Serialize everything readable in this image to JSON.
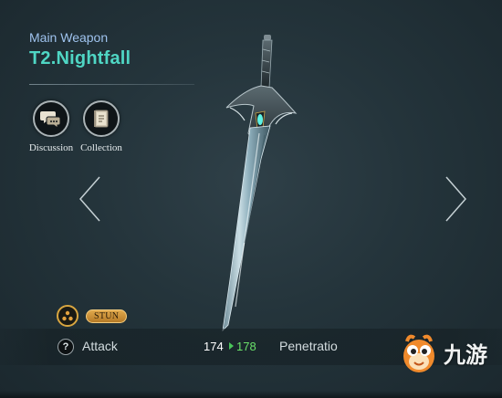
{
  "weapon": {
    "category": "Main Weapon",
    "name": "T2.Nightfall"
  },
  "actions": {
    "discussion_label": "Discussion",
    "collection_label": "Collection"
  },
  "navigation": {
    "prev_icon": "chevron-left-icon",
    "next_icon": "chevron-right-icon"
  },
  "skill": {
    "tag": "STUN"
  },
  "stats": {
    "help_glyph": "?",
    "primary_label": "Attack",
    "primary_old": "174",
    "primary_new": "178",
    "secondary_label": "Penetratio"
  },
  "watermark": {
    "text": "九游"
  },
  "colors": {
    "title": "#4fd6c4",
    "subtitle": "#9fc3ee",
    "increase": "#6ae06a",
    "badge": "#d9a640"
  }
}
